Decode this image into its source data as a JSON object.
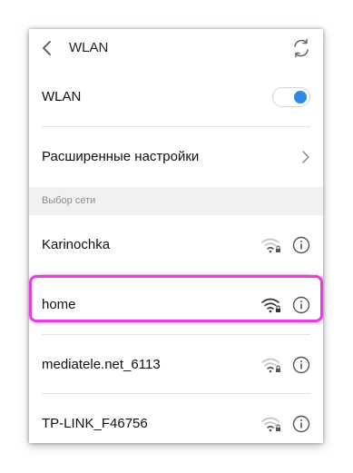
{
  "header": {
    "title": "WLAN",
    "back_icon": "chevron-left-icon",
    "refresh_icon": "refresh-icon"
  },
  "wlan_toggle": {
    "label": "WLAN",
    "state": "on",
    "accent": "#2b8ae6"
  },
  "advanced_settings": {
    "label": "Расширенные настройки"
  },
  "network_section": {
    "label": "Выбор сети"
  },
  "networks": [
    {
      "name": "Karinochka",
      "signal": "weak",
      "locked": true
    },
    {
      "name": "home",
      "signal": "strong",
      "locked": true,
      "highlighted": true
    },
    {
      "name": "mediatele.net_6113",
      "signal": "weak",
      "locked": true
    },
    {
      "name": "TP-LINK_F46756",
      "signal": "weak",
      "locked": true
    }
  ],
  "highlight_color": "#e83ee0"
}
